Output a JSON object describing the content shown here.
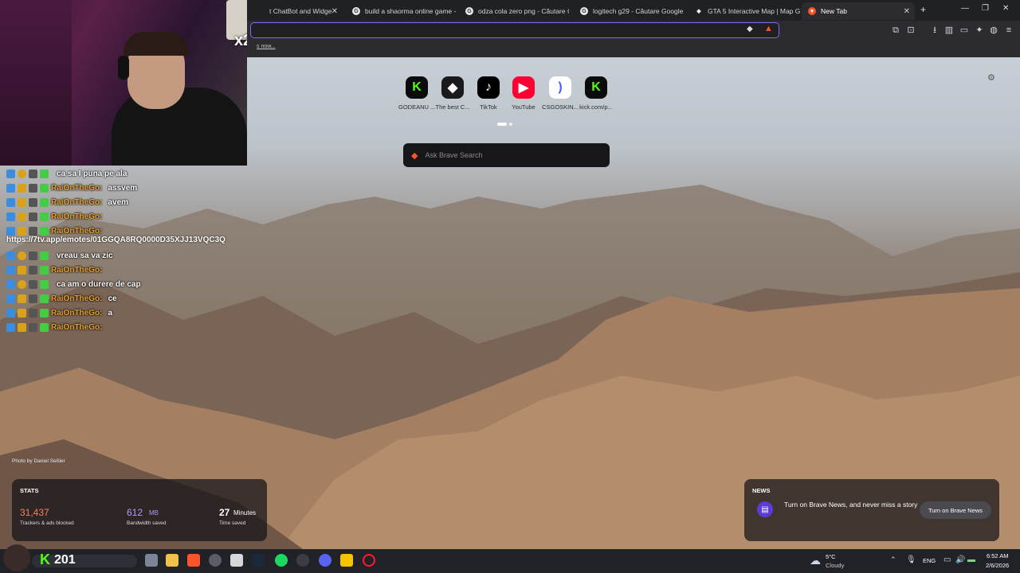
{
  "tabs": [
    {
      "title": "t ChatBot and Widge"
    },
    {
      "title": "build a shaorma online game - Că"
    },
    {
      "title": "odza cola zero png - Căutare Goo"
    },
    {
      "title": "logitech g29 - Căutare Google"
    },
    {
      "title": "GTA 5 Interactive Map | Map Geni"
    },
    {
      "title": "New Tab"
    }
  ],
  "overlay": {
    "multiplier": "x2",
    "bookmark_hint": "s now..."
  },
  "top_sites": [
    {
      "label": "GODEANU ...",
      "glyph": "K",
      "color": "#53fc18",
      "bg": "#0b0b0b"
    },
    {
      "label": "The best C...",
      "glyph": "◆",
      "color": "#ffffff",
      "bg": "#1a1a1a"
    },
    {
      "label": "TikTok",
      "glyph": "♪",
      "color": "#ffffff",
      "bg": "#000000"
    },
    {
      "label": "YouTube",
      "glyph": "▶",
      "color": "#ffffff",
      "bg": "#ff0033"
    },
    {
      "label": "CSGOSKIN...",
      "glyph": ")",
      "color": "#4b5cff",
      "bg": "#ffffff"
    },
    {
      "label": "kick.com/p...",
      "glyph": "K",
      "color": "#53fc18",
      "bg": "#0b0b0b"
    }
  ],
  "search": {
    "placeholder": "Ask Brave Search"
  },
  "chat": [
    {
      "user": "",
      "color": "#a36ce0",
      "msg": "ca sa I puna pe ala"
    },
    {
      "user": "RaiOnTheGo:",
      "color": "#e7a12d",
      "msg": "assvem"
    },
    {
      "user": "RaiOnTheGo:",
      "color": "#e7a12d",
      "msg": "avem"
    },
    {
      "user": "RaiOnTheGo:",
      "color": "#e7a12d",
      "msg": ""
    },
    {
      "user": "RaiOnTheGo:",
      "color": "#e7a12d",
      "msg": ""
    },
    {
      "user": "",
      "color": "#a36ce0",
      "msg": "vreau sa va zic"
    },
    {
      "user": "RaiOnTheGo:",
      "color": "#e7a12d",
      "msg": ""
    },
    {
      "user": "",
      "color": "#a36ce0",
      "msg": "ca am o durere de cap"
    },
    {
      "user": "RaiOnTheGo:",
      "color": "#e7a12d",
      "msg": "ce"
    },
    {
      "user": "RaiOnTheGo:",
      "color": "#e7a12d",
      "msg": "a"
    },
    {
      "user": "RaiOnTheGo:",
      "color": "#e7a12d",
      "msg": ""
    }
  ],
  "chat_link": "https://7tv.app/emotes/01GGQA8RQ0000D35XJJ13VQC3Q",
  "photo_credit": "Photo by Daniel Seßler",
  "stats": {
    "title": "STATS",
    "trackers_value": "31,437",
    "trackers_label": "Trackers & ads blocked",
    "bandwidth_value": "612",
    "bandwidth_unit": "MB",
    "bandwidth_label": "Bandwidth saved",
    "time_value": "27",
    "time_unit": "Minutes",
    "time_label": "Time saved"
  },
  "news": {
    "title": "NEWS",
    "text": "Turn on Brave News, and never miss a story",
    "button": "Turn on Brave News"
  },
  "taskbar": {
    "counter": "201",
    "weather_temp": "5°C",
    "weather_desc": "Cloudy",
    "lang": "ENG",
    "time": "6:52 AM",
    "date": "2/6/2026"
  },
  "colors": {
    "accent": "#7b6cf0",
    "brave": "#fb542b",
    "kick": "#53fc18"
  }
}
